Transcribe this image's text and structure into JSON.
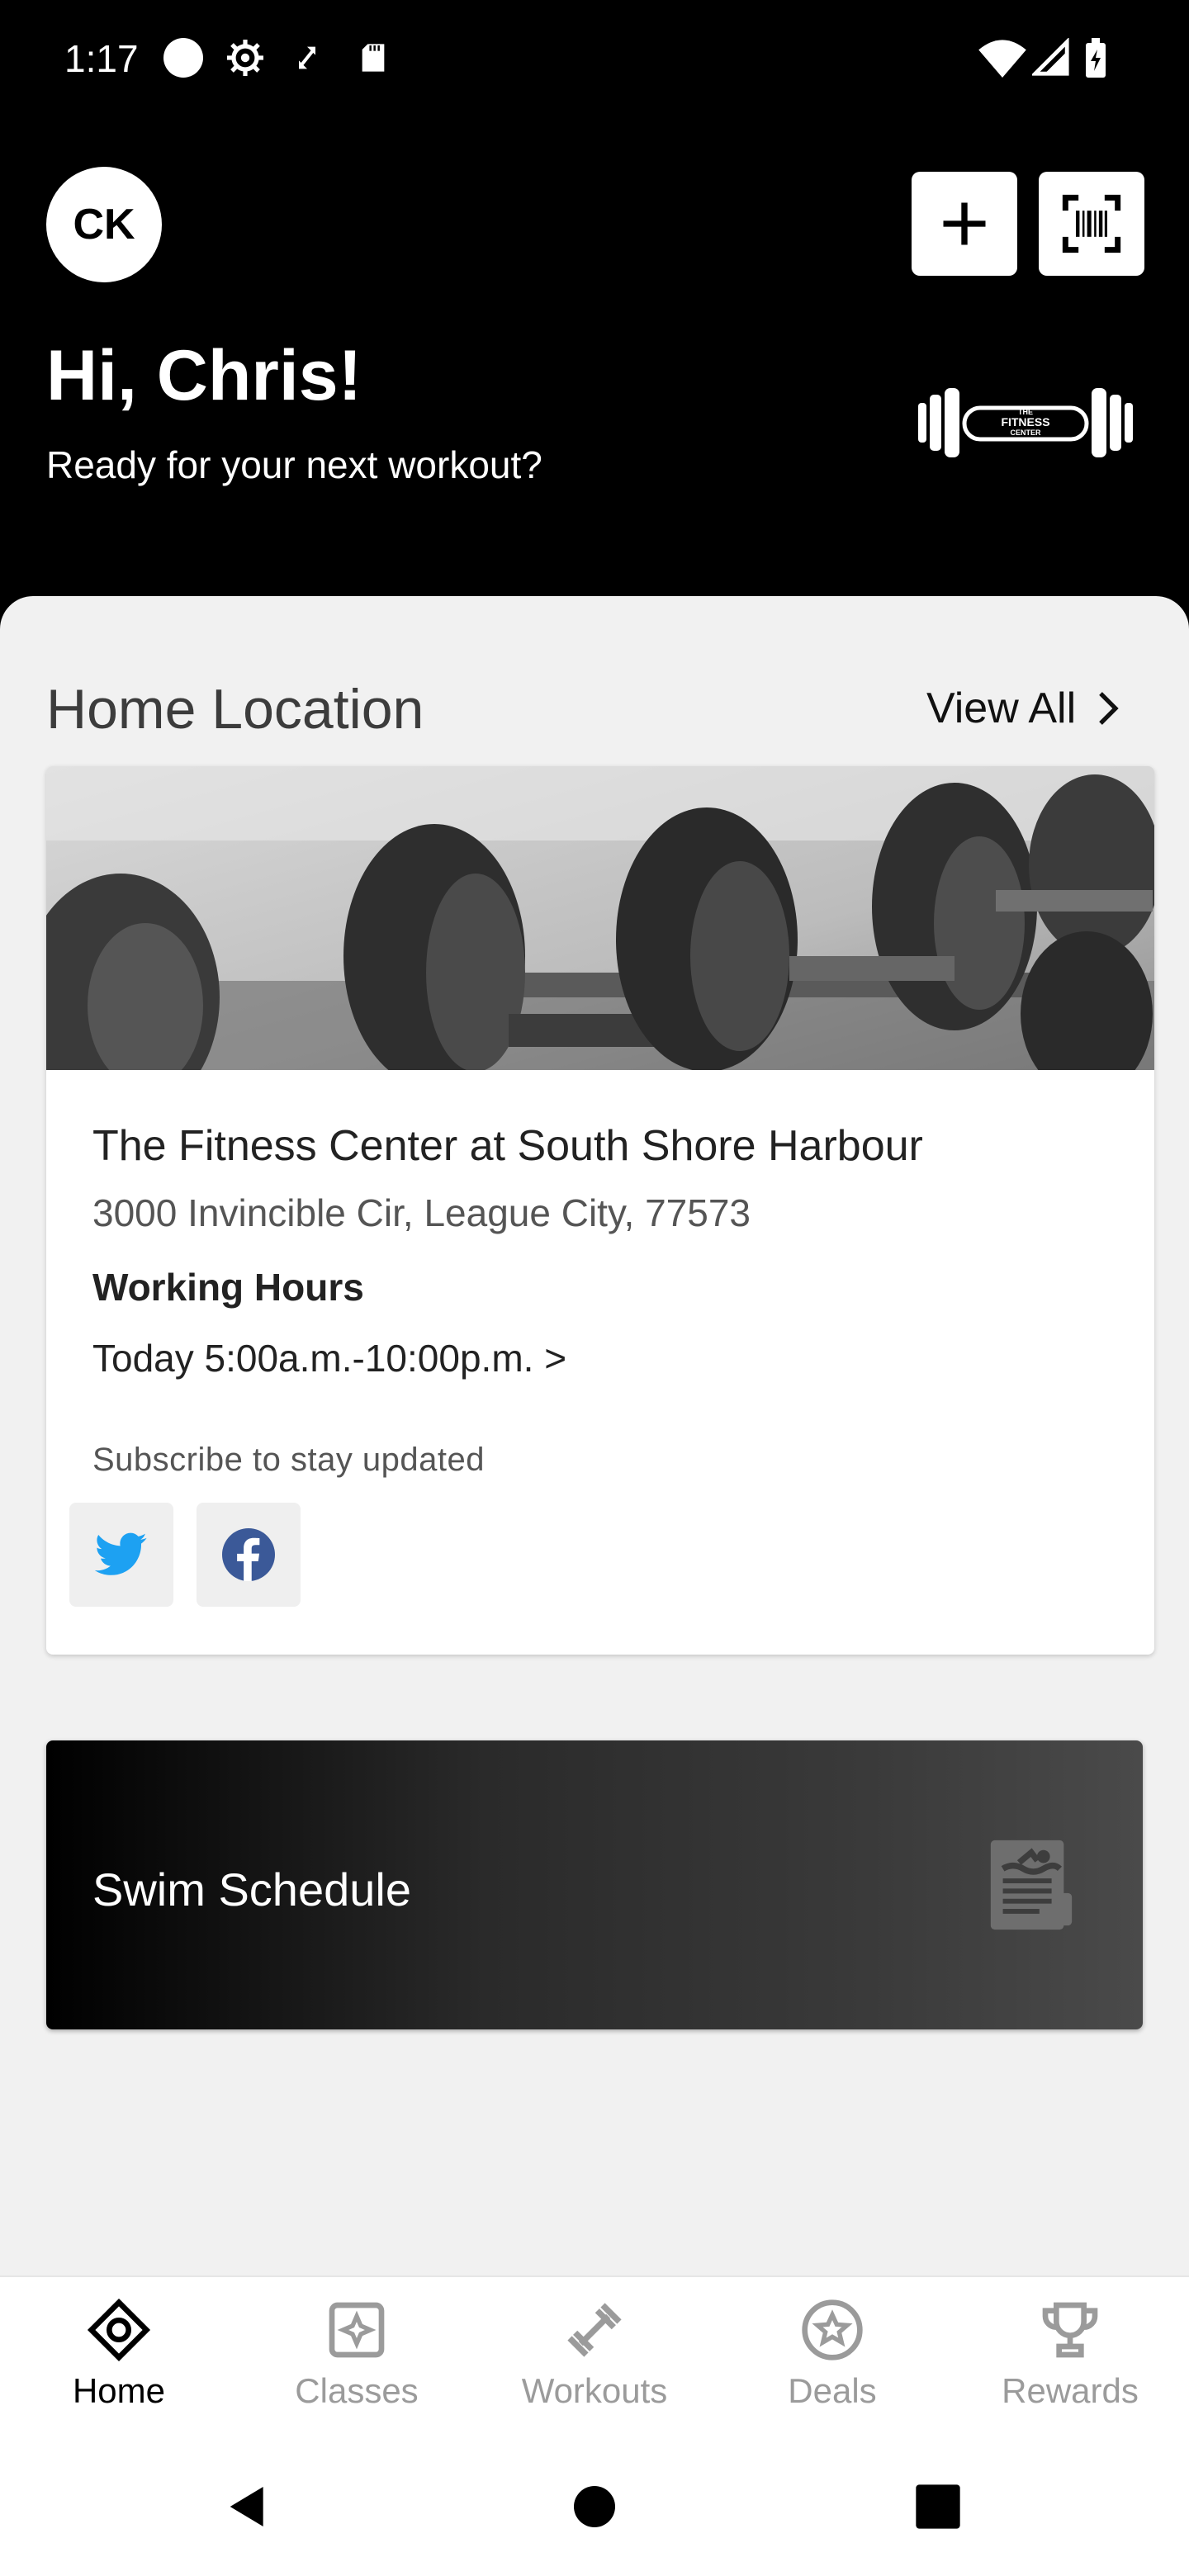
{
  "status_bar": {
    "time": "1:17",
    "icons": [
      "circle-icon",
      "gear-icon",
      "sync-icon",
      "sd-card-icon",
      "wifi-icon",
      "signal-icon",
      "battery-icon"
    ]
  },
  "header": {
    "avatar_initials": "CK",
    "greeting": "Hi, Chris!",
    "subtitle": "Ready for your next workout?",
    "logo_text": [
      "THE",
      "FITNESS",
      "CENTER"
    ],
    "icons": [
      "plus-icon",
      "barcode-scan-icon"
    ]
  },
  "home_location": {
    "section_title": "Home Location",
    "view_all_label": "View All",
    "card": {
      "title": "The Fitness Center at South Shore Harbour",
      "address": "3000 Invincible Cir, League City, 77573",
      "hours_title": "Working Hours",
      "hours_value": "Today 5:00a.m.-10:00p.m. >",
      "subscribe_text": "Subscribe to stay updated",
      "social": [
        "twitter-icon",
        "facebook-icon"
      ]
    }
  },
  "swim_card": {
    "title": "Swim Schedule"
  },
  "bottom_nav": {
    "items": [
      {
        "label": "Home",
        "icon": "home-icon",
        "active": true
      },
      {
        "label": "Classes",
        "icon": "classes-icon",
        "active": false
      },
      {
        "label": "Workouts",
        "icon": "dumbbell-icon",
        "active": false
      },
      {
        "label": "Deals",
        "icon": "deals-star-icon",
        "active": false
      },
      {
        "label": "Rewards",
        "icon": "trophy-icon",
        "active": false
      }
    ]
  },
  "colors": {
    "header_bg": "#000000",
    "main_bg": "#f1f1f1",
    "twitter": "#1da1f2",
    "facebook": "#3b5998",
    "nav_inactive": "#9b9b9b"
  }
}
